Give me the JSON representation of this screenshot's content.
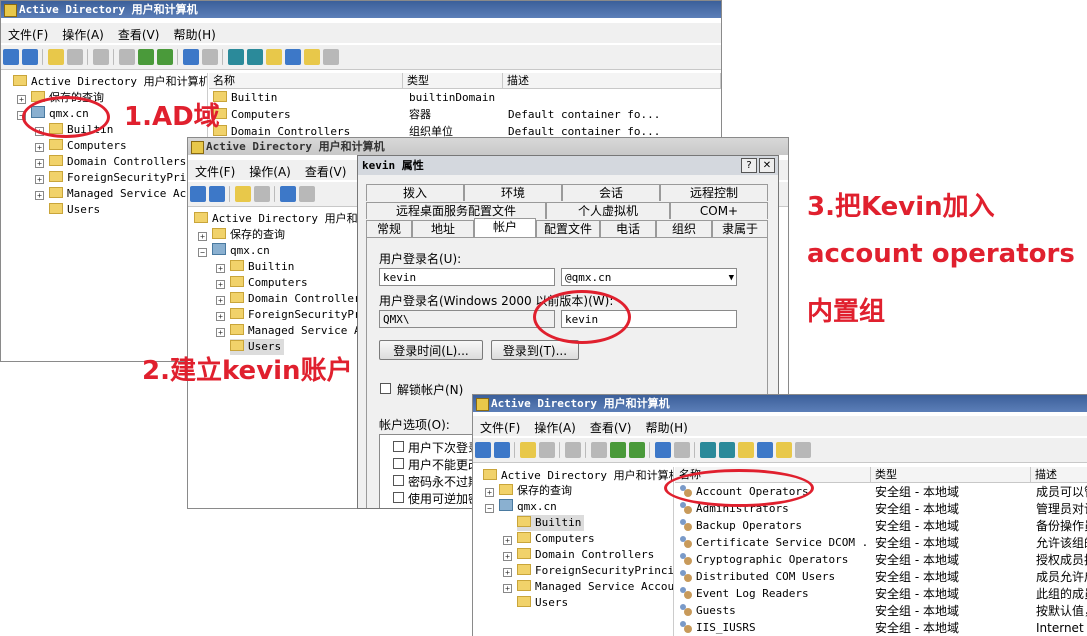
{
  "app_title": "Active Directory 用户和计算机",
  "menu": [
    "文件(F)",
    "操作(A)",
    "查看(V)",
    "帮助(H)"
  ],
  "tree": {
    "root": "Active Directory 用户和计算机",
    "saved_queries": "保存的查询",
    "domain": "qmx.cn",
    "children": [
      "Builtin",
      "Computers",
      "Domain Controllers",
      "ForeignSecurityPrincipals",
      "Managed Service Accounts",
      "Users"
    ]
  },
  "win1": {
    "tree_root": "Active Directory 用户和计算机",
    "tree_children": [
      "Builtin",
      "Computers",
      "Domain Controllers",
      "ForeignSecurityPrinc",
      "Managed Service Acco",
      "Users"
    ],
    "columns": [
      "名称",
      "类型",
      "描述"
    ],
    "rows": [
      {
        "name": "Builtin",
        "type": "builtinDomain",
        "desc": ""
      },
      {
        "name": "Computers",
        "type": "容器",
        "desc": "Default container fo..."
      },
      {
        "name": "Domain Controllers",
        "type": "组织单位",
        "desc": "Default container fo..."
      }
    ]
  },
  "win2": {
    "tree_root": "Active Directory 用户和计",
    "tree_children": [
      "Builtin",
      "Computers",
      "Domain Controllers",
      "ForeignSecurityPri",
      "Managed Service Ac",
      "Users"
    ]
  },
  "dialog": {
    "title": "kevin 属性",
    "help_btn": "?",
    "close_btn": "✕",
    "tabs_row1": [
      "拨入",
      "环境",
      "会话",
      "远程控制"
    ],
    "tabs_row2": [
      "远程桌面服务配置文件",
      "个人虚拟机",
      "COM+"
    ],
    "tabs_row3": [
      "常规",
      "地址",
      "帐户",
      "配置文件",
      "电话",
      "组织",
      "隶属于"
    ],
    "logon_name_label": "用户登录名(U):",
    "logon_name_value": "kevin",
    "domain_suffix": "@qmx.cn",
    "pre2000_label": "用户登录名(Windows 2000 以前版本)(W):",
    "pre2000_domain": "QMX\\",
    "pre2000_user": "kevin",
    "logon_hours_btn": "登录时间(L)...",
    "logon_to_btn": "登录到(T)...",
    "unlock_label": "解锁帐户(N)",
    "options_label": "帐户选项(O):",
    "options": [
      "用户下次登录",
      "用户不能更改",
      "密码永不过期",
      "使用可逆加密"
    ]
  },
  "win3": {
    "tree_children": [
      "Builtin",
      "Computers",
      "Domain Controllers",
      "ForeignSecurityPrincip",
      "Managed Service Accour",
      "Users"
    ],
    "columns": [
      "名称",
      "类型",
      "描述"
    ],
    "rows": [
      {
        "name": "Account Operators",
        "type": "安全组 - 本地域",
        "desc": "成员可以管"
      },
      {
        "name": "Administrators",
        "type": "安全组 - 本地域",
        "desc": "管理员对计"
      },
      {
        "name": "Backup Operators",
        "type": "安全组 - 本地域",
        "desc": "备份操作员"
      },
      {
        "name": "Certificate Service DCOM ...",
        "type": "安全组 - 本地域",
        "desc": "允许该组的"
      },
      {
        "name": "Cryptographic Operators",
        "type": "安全组 - 本地域",
        "desc": "授权成员执"
      },
      {
        "name": "Distributed COM Users",
        "type": "安全组 - 本地域",
        "desc": "成员允许启"
      },
      {
        "name": "Event Log Readers",
        "type": "安全组 - 本地域",
        "desc": "此组的成员"
      },
      {
        "name": "Guests",
        "type": "安全组 - 本地域",
        "desc": "按默认值，"
      },
      {
        "name": "IIS_IUSRS",
        "type": "安全组 - 本地域",
        "desc": "Internet 信"
      }
    ]
  },
  "annotations": {
    "a1": "1.AD域",
    "a2": "2.建立kevin账户",
    "a3_line1": "3.把Kevin加入",
    "a3_line2": "account operators",
    "a3_line3": "内置组"
  },
  "colors": {
    "annotation_red": "#e0202e",
    "title_blue": "#3b5f9a"
  }
}
